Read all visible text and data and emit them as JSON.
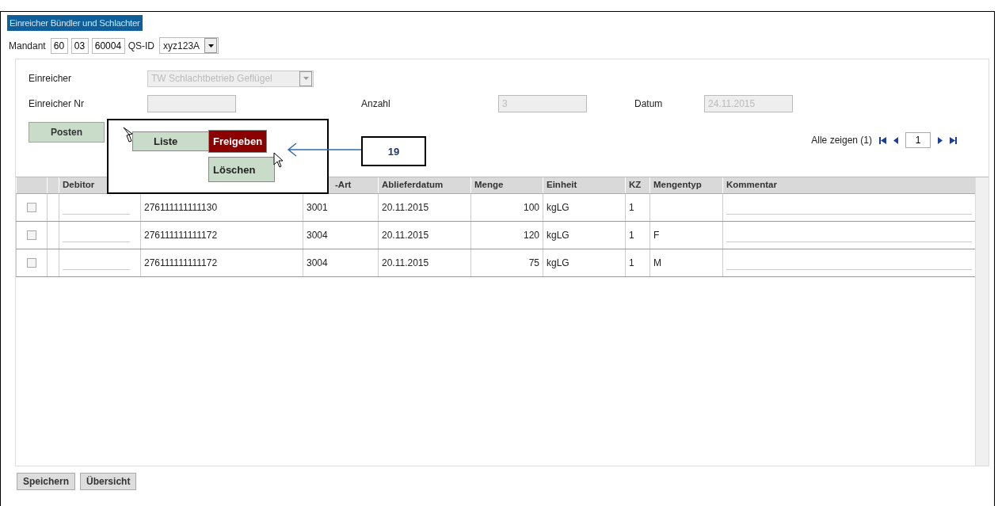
{
  "tab": {
    "title": "Einreicher Bündler und Schlachter"
  },
  "mandant": {
    "label": "Mandant",
    "fields": [
      "60",
      "03",
      "60004"
    ]
  },
  "qs_id": {
    "label": "QS-ID",
    "value": "xyz123A"
  },
  "form": {
    "einreicher": {
      "label": "Einreicher",
      "value": "TW Schlachtbetrieb Geflügel",
      "disabled": true
    },
    "einreicher_nr": {
      "label": "Einreicher Nr",
      "disabled": true
    },
    "anzahl": {
      "label": "Anzahl",
      "value": "3",
      "disabled": true
    },
    "datum": {
      "label": "Datum",
      "value": "24.11.2015",
      "disabled": true
    }
  },
  "posten_button": "Posten",
  "pagination": {
    "label": "Alle zeigen (1)",
    "page": "1"
  },
  "table": {
    "headers": [
      "Debitor",
      "-Art",
      "Ablieferdatum",
      "Menge",
      "Einheit",
      "KZ",
      "Mengentyp",
      "Kommentar"
    ],
    "rows": [
      {
        "checked": false,
        "id": "276111111111130",
        "art": "3001",
        "date": "20.11.2015",
        "menge": "100",
        "einheit": "kgLG",
        "kz": "1"
      },
      {
        "checked": false,
        "id": "276111111111172",
        "art": "3004",
        "date": "20.11.2015",
        "menge": "120",
        "einheit": "kgLG",
        "kz": "1",
        "mengentyp": "F"
      },
      {
        "checked": false,
        "id": "276111111111172",
        "art": "3004",
        "date": "20.11.2015",
        "menge": "75",
        "einheit": "kgLG",
        "kz": "1",
        "mengentyp": "M"
      }
    ]
  },
  "callout": {
    "menu": [
      {
        "label": "Liste",
        "selected": false
      },
      {
        "label": "Freigeben",
        "selected": true
      },
      {
        "label": "Löschen",
        "selected": false
      }
    ],
    "number": "19"
  },
  "footer_buttons": [
    "Speichern",
    "Übersicht"
  ]
}
